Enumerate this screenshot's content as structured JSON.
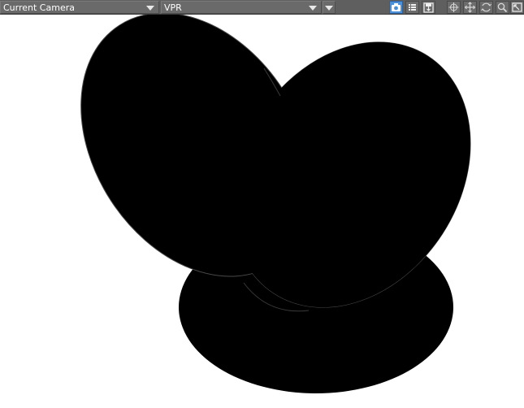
{
  "toolbar": {
    "camera_dropdown": {
      "value": "Current Camera",
      "icon": "chevron-down-icon"
    },
    "mode_dropdown": {
      "value": "VPR",
      "icon": "chevron-down-icon"
    },
    "extra_dropdown": {
      "icon": "chevron-down-icon"
    },
    "buttons": [
      {
        "name": "camera-icon",
        "active": true
      },
      {
        "name": "list-icon",
        "active": false
      },
      {
        "name": "save-icon",
        "active": false
      },
      {
        "name": "crosshair-icon",
        "active": false
      },
      {
        "name": "move-icon",
        "active": false
      },
      {
        "name": "rotate-icon",
        "active": false
      },
      {
        "name": "zoom-icon",
        "active": false
      },
      {
        "name": "maximize-icon",
        "active": false
      }
    ],
    "colors": {
      "bar": "#5f5f5f",
      "active": "#4a8fd8"
    }
  },
  "viewport": {
    "background": "#ffffff",
    "shapes_color": "#000000"
  }
}
